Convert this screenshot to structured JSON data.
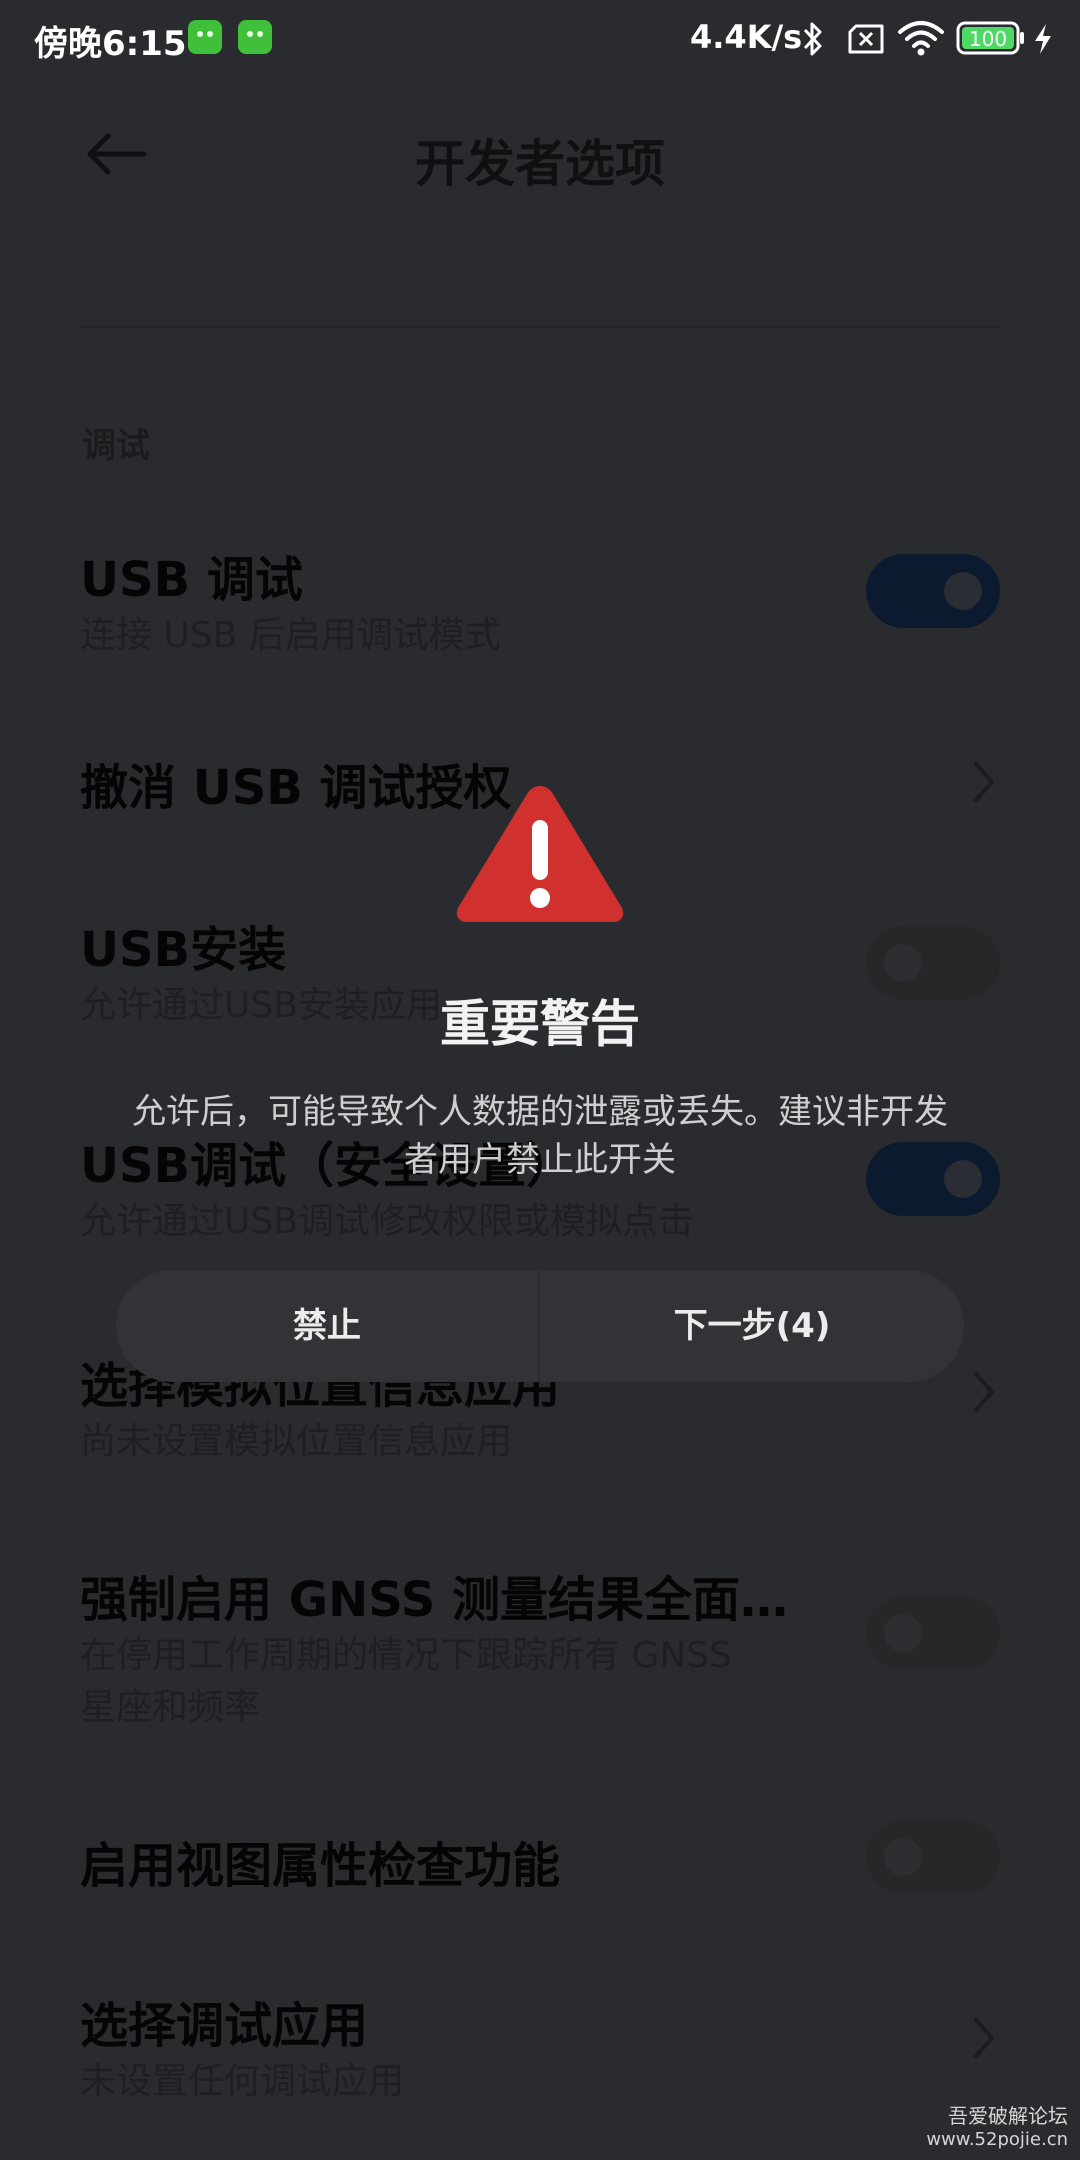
{
  "status_bar": {
    "time": "傍晚6:15",
    "network_speed": "4.4K/s",
    "battery": "100",
    "icons": [
      "app-notification-icon",
      "app-notification-icon",
      "bluetooth-icon",
      "no-sim-icon",
      "wifi-icon",
      "battery-icon",
      "charging-icon"
    ]
  },
  "header": {
    "title": "开发者选项",
    "back_icon": "back-arrow-icon"
  },
  "section": {
    "label": "调试"
  },
  "settings": [
    {
      "title": "USB 调试",
      "subtitle": "连接 USB 后启用调试模式",
      "control": "toggle",
      "state": "on"
    },
    {
      "title": "撤消 USB 调试授权",
      "subtitle": "",
      "control": "chevron"
    },
    {
      "title": "USB安装",
      "subtitle": "允许通过USB安装应用",
      "control": "toggle",
      "state": "off"
    },
    {
      "title": "USB调试（安全设置）",
      "subtitle": "允许通过USB调试修改权限或模拟点击",
      "control": "toggle",
      "state": "on"
    },
    {
      "title": "选择模拟位置信息应用",
      "subtitle": "尚未设置模拟位置信息应用",
      "control": "chevron"
    },
    {
      "title": "强制启用 GNSS 测量结果全面…",
      "subtitle": "在停用工作周期的情况下跟踪所有 GNSS",
      "subtitle2": "星座和频率",
      "control": "toggle",
      "state": "off"
    },
    {
      "title": "启用视图属性检查功能",
      "subtitle": "",
      "control": "toggle",
      "state": "off"
    },
    {
      "title": "选择调试应用",
      "subtitle": "未设置任何调试应用",
      "control": "chevron"
    }
  ],
  "dialog": {
    "icon": "warning-icon",
    "title": "重要警告",
    "message_line1": "允许后，可能导致个人数据的泄露或丢失。建议非开发",
    "message_line2": "者用户禁止此开关",
    "deny_label": "禁止",
    "next_label": "下一步(4)"
  },
  "colors": {
    "warning_red": "#d32f2f",
    "dim_background": "#2a2b2f",
    "toggle_on": "#0b1a2e"
  },
  "watermark": {
    "line1": "吾爱破解论坛",
    "line2": "www.52pojie.cn"
  }
}
